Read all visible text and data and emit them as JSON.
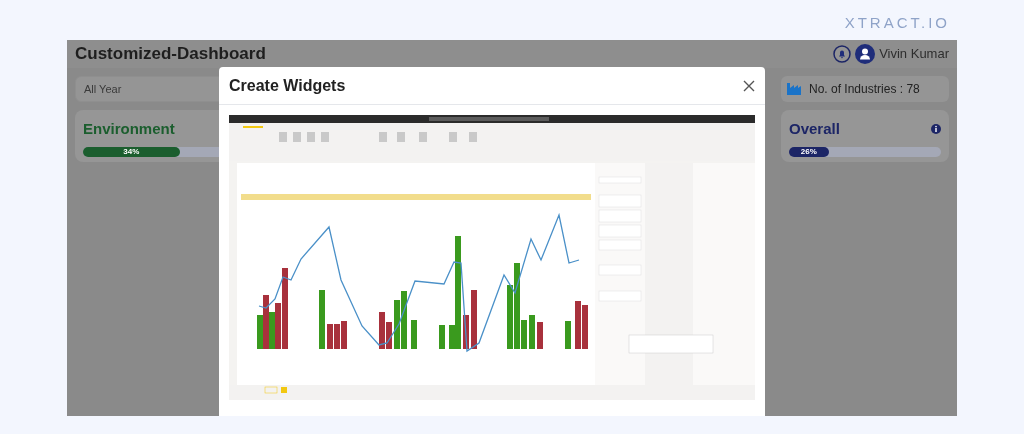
{
  "brand": {
    "logo": "XTRACT.IO"
  },
  "dashboard": {
    "title": "Customized-Dashboard",
    "user": {
      "name": "Vivin Kumar"
    },
    "filter": {
      "value": "All Year"
    },
    "stat": {
      "label": "No. of Industries : 78"
    },
    "cards": [
      {
        "title": "Environment",
        "level": 0.34,
        "reading": "34%",
        "color": "#1b5e2e"
      },
      {
        "title": "Overall",
        "level": 0.26,
        "reading": "26%",
        "color": "#1c2566",
        "info": true
      }
    ]
  },
  "modal": {
    "title": "Create Widgets"
  }
}
